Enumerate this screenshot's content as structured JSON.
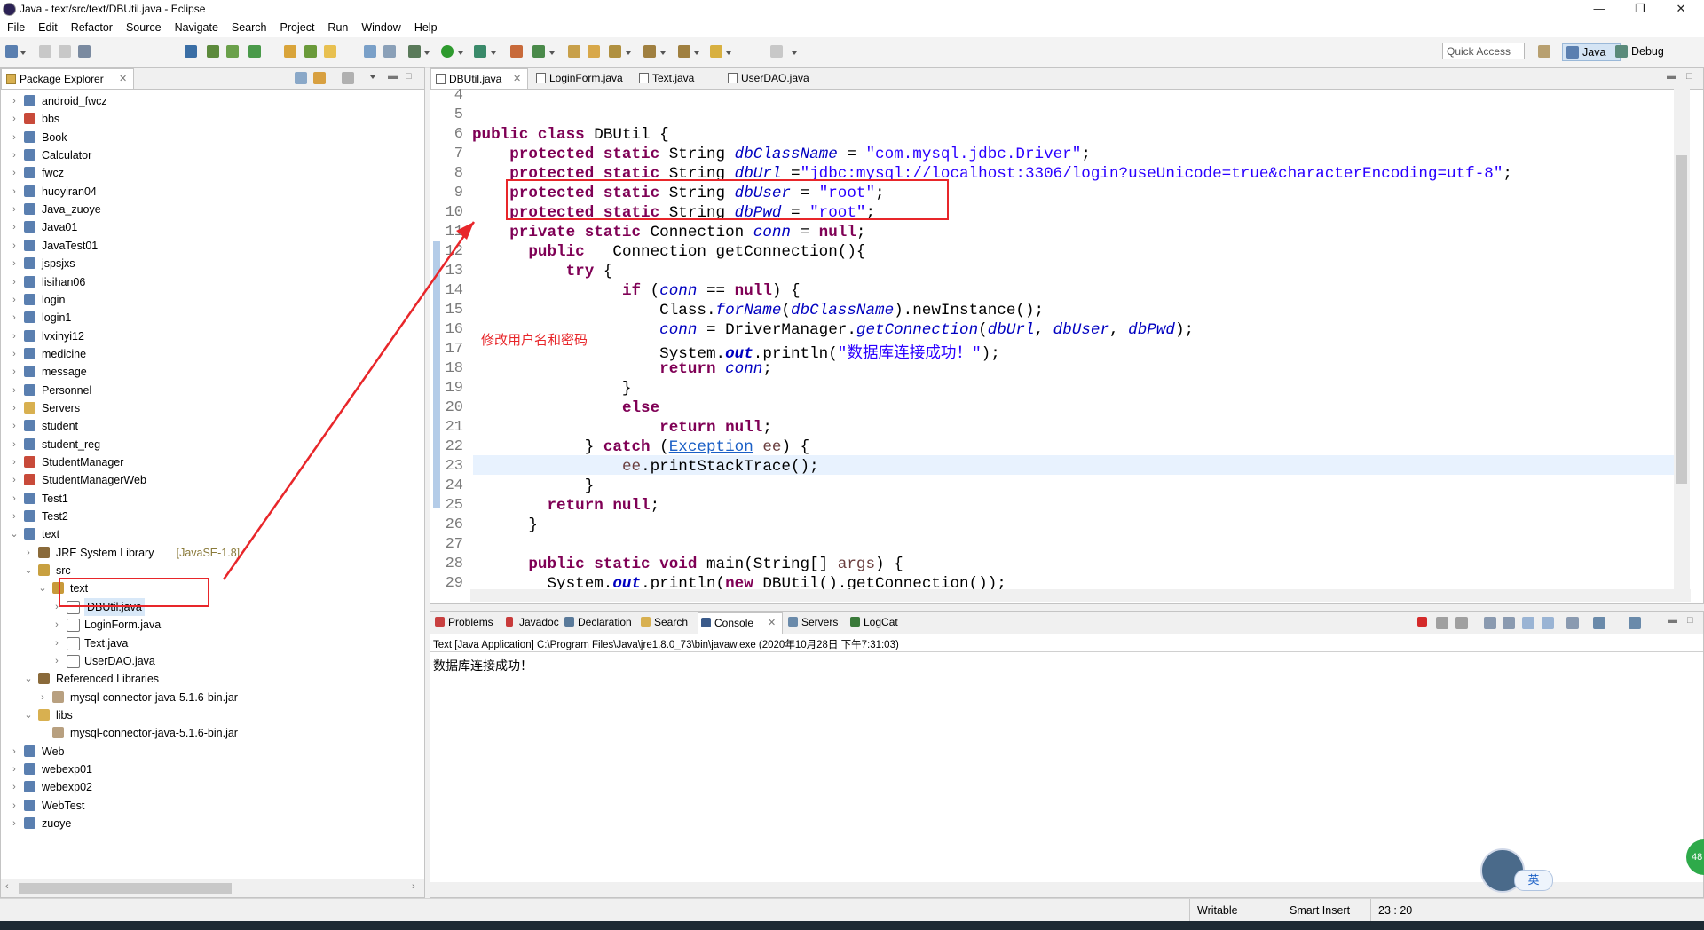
{
  "window": {
    "title": "Java - text/src/text/DBUtil.java - Eclipse"
  },
  "menu": [
    "File",
    "Edit",
    "Refactor",
    "Source",
    "Navigate",
    "Search",
    "Project",
    "Run",
    "Window",
    "Help"
  ],
  "toolbar": {
    "quick_access": "Quick Access"
  },
  "perspectives": {
    "java": "Java",
    "debug": "Debug"
  },
  "package_explorer": {
    "title": "Package Explorer",
    "items": [
      {
        "label": "android_fwcz",
        "depth": 0,
        "state": "closed",
        "icon": "project-icon"
      },
      {
        "label": "bbs",
        "depth": 0,
        "state": "closed",
        "icon": "project-error-icon"
      },
      {
        "label": "Book",
        "depth": 0,
        "state": "closed",
        "icon": "project-icon"
      },
      {
        "label": "Calculator",
        "depth": 0,
        "state": "closed",
        "icon": "project-icon"
      },
      {
        "label": "fwcz",
        "depth": 0,
        "state": "closed",
        "icon": "project-icon"
      },
      {
        "label": "huoyiran04",
        "depth": 0,
        "state": "closed",
        "icon": "project-icon"
      },
      {
        "label": "Java_zuoye",
        "depth": 0,
        "state": "closed",
        "icon": "project-icon"
      },
      {
        "label": "Java01",
        "depth": 0,
        "state": "closed",
        "icon": "project-icon"
      },
      {
        "label": "JavaTest01",
        "depth": 0,
        "state": "closed",
        "icon": "project-icon"
      },
      {
        "label": "jspsjxs",
        "depth": 0,
        "state": "closed",
        "icon": "project-icon"
      },
      {
        "label": "lisihan06",
        "depth": 0,
        "state": "closed",
        "icon": "project-icon"
      },
      {
        "label": "login",
        "depth": 0,
        "state": "closed",
        "icon": "project-icon"
      },
      {
        "label": "login1",
        "depth": 0,
        "state": "closed",
        "icon": "project-icon"
      },
      {
        "label": "lvxinyi12",
        "depth": 0,
        "state": "closed",
        "icon": "project-icon"
      },
      {
        "label": "medicine",
        "depth": 0,
        "state": "closed",
        "icon": "project-icon"
      },
      {
        "label": "message",
        "depth": 0,
        "state": "closed",
        "icon": "project-icon"
      },
      {
        "label": "Personnel",
        "depth": 0,
        "state": "closed",
        "icon": "project-icon"
      },
      {
        "label": "Servers",
        "depth": 0,
        "state": "closed",
        "icon": "folder-icon"
      },
      {
        "label": "student",
        "depth": 0,
        "state": "closed",
        "icon": "project-icon"
      },
      {
        "label": "student_reg",
        "depth": 0,
        "state": "closed",
        "icon": "project-icon"
      },
      {
        "label": "StudentManager",
        "depth": 0,
        "state": "closed",
        "icon": "project-error-icon"
      },
      {
        "label": "StudentManagerWeb",
        "depth": 0,
        "state": "closed",
        "icon": "project-error-icon"
      },
      {
        "label": "Test1",
        "depth": 0,
        "state": "closed",
        "icon": "project-icon"
      },
      {
        "label": "Test2",
        "depth": 0,
        "state": "closed",
        "icon": "project-icon"
      },
      {
        "label": "text",
        "depth": 0,
        "state": "open",
        "icon": "project-icon"
      },
      {
        "label": "JRE System Library",
        "suffix": "[JavaSE-1.8]",
        "depth": 1,
        "state": "closed",
        "icon": "library-icon"
      },
      {
        "label": "src",
        "depth": 1,
        "state": "open",
        "icon": "source-folder-icon"
      },
      {
        "label": "text",
        "depth": 2,
        "state": "open",
        "icon": "package-icon"
      },
      {
        "label": "DBUtil.java",
        "depth": 3,
        "state": "closed",
        "icon": "java-file-icon",
        "selected": true
      },
      {
        "label": "LoginForm.java",
        "depth": 3,
        "state": "closed",
        "icon": "java-file-icon"
      },
      {
        "label": "Text.java",
        "depth": 3,
        "state": "closed",
        "icon": "java-file-icon"
      },
      {
        "label": "UserDAO.java",
        "depth": 3,
        "state": "closed",
        "icon": "java-file-icon"
      },
      {
        "label": "Referenced Libraries",
        "depth": 1,
        "state": "open",
        "icon": "library-icon"
      },
      {
        "label": "mysql-connector-java-5.1.6-bin.jar",
        "depth": 2,
        "state": "closed",
        "icon": "jar-icon"
      },
      {
        "label": "libs",
        "depth": 1,
        "state": "open",
        "icon": "folder-icon"
      },
      {
        "label": "mysql-connector-java-5.1.6-bin.jar",
        "depth": 2,
        "state": "none",
        "icon": "jar-icon"
      },
      {
        "label": "Web",
        "depth": 0,
        "state": "closed",
        "icon": "project-icon"
      },
      {
        "label": "webexp01",
        "depth": 0,
        "state": "closed",
        "icon": "project-icon"
      },
      {
        "label": "webexp02",
        "depth": 0,
        "state": "closed",
        "icon": "project-icon"
      },
      {
        "label": "WebTest",
        "depth": 0,
        "state": "closed",
        "icon": "project-icon"
      },
      {
        "label": "zuoye",
        "depth": 0,
        "state": "closed",
        "icon": "project-icon"
      }
    ]
  },
  "editor": {
    "tabs": [
      "DBUtil.java",
      "LoginForm.java",
      "Text.java",
      "UserDAO.java"
    ],
    "line_numbers": [
      "4",
      "5",
      "6",
      "7",
      "8",
      "9",
      "10",
      "11",
      "12",
      "13",
      "14",
      "15",
      "16",
      "17",
      "18",
      "19",
      "20",
      "21",
      "22",
      "23",
      "24",
      "25",
      "26",
      "27",
      "28",
      "29"
    ],
    "lines": [
      [],
      [],
      [
        [
          "kw",
          "public class "
        ],
        [
          "",
          "DBUtil {"
        ]
      ],
      [
        [
          "",
          "    "
        ],
        [
          "kw",
          "protected static "
        ],
        [
          "",
          "String "
        ],
        [
          "fld",
          "dbClassName"
        ],
        [
          "",
          " = "
        ],
        [
          "st",
          "\"com.mysql.jdbc.Driver\""
        ],
        [
          "",
          ";"
        ]
      ],
      [
        [
          "",
          "    "
        ],
        [
          "kw",
          "protected static "
        ],
        [
          "",
          "String "
        ],
        [
          "fld",
          "dbUrl"
        ],
        [
          "",
          " ="
        ],
        [
          "st",
          "\"jdbc:mysql://localhost:3306/login?useUnicode=true&characterEncoding=utf-8\""
        ],
        [
          "",
          ";"
        ]
      ],
      [
        [
          "",
          "    "
        ],
        [
          "kw",
          "protected static "
        ],
        [
          "",
          "String "
        ],
        [
          "fld",
          "dbUser"
        ],
        [
          "",
          " = "
        ],
        [
          "st",
          "\"root\""
        ],
        [
          "",
          ";"
        ]
      ],
      [
        [
          "",
          "    "
        ],
        [
          "kw",
          "protected static "
        ],
        [
          "",
          "String "
        ],
        [
          "fld",
          "dbPwd"
        ],
        [
          "",
          " = "
        ],
        [
          "st",
          "\"root\""
        ],
        [
          "",
          ";"
        ]
      ],
      [
        [
          "",
          "    "
        ],
        [
          "kw",
          "private static "
        ],
        [
          "",
          "Connection "
        ],
        [
          "fld",
          "conn"
        ],
        [
          "",
          " = "
        ],
        [
          "kw",
          "null"
        ],
        [
          "",
          ";"
        ]
      ],
      [
        [
          "",
          "      "
        ],
        [
          "kw",
          "public "
        ],
        [
          "",
          "  Connection getConnection(){"
        ]
      ],
      [
        [
          "",
          "          "
        ],
        [
          "kw",
          "try "
        ],
        [
          "",
          "{"
        ]
      ],
      [
        [
          "",
          "                "
        ],
        [
          "kw",
          "if "
        ],
        [
          "",
          "("
        ],
        [
          "fld",
          "conn"
        ],
        [
          "",
          " == "
        ],
        [
          "kw",
          "null"
        ],
        [
          "",
          ") {"
        ]
      ],
      [
        [
          "",
          "                    Class."
        ],
        [
          "fld",
          "forName"
        ],
        [
          "",
          "("
        ],
        [
          "fld",
          "dbClassName"
        ],
        [
          "",
          ").newInstance();"
        ]
      ],
      [
        [
          "",
          "                    "
        ],
        [
          "fld",
          "conn"
        ],
        [
          "",
          " = DriverManager."
        ],
        [
          "fld",
          "getConnection"
        ],
        [
          "",
          "("
        ],
        [
          "fld",
          "dbUrl"
        ],
        [
          "",
          ", "
        ],
        [
          "fld",
          "dbUser"
        ],
        [
          "",
          ", "
        ],
        [
          "fld",
          "dbPwd"
        ],
        [
          "",
          ");"
        ]
      ],
      [
        [
          "",
          "                    System."
        ],
        [
          "sfld",
          "out"
        ],
        [
          "",
          ".println("
        ],
        [
          "st",
          "\"数据库连接成功！\""
        ],
        [
          "",
          ");"
        ]
      ],
      [
        [
          "",
          "                    "
        ],
        [
          "kw",
          "return "
        ],
        [
          "fld",
          "conn"
        ],
        [
          "",
          ";"
        ]
      ],
      [
        [
          "",
          "                }"
        ]
      ],
      [
        [
          "",
          "                "
        ],
        [
          "kw",
          "else"
        ]
      ],
      [
        [
          "",
          "                    "
        ],
        [
          "kw",
          "return null"
        ],
        [
          "",
          ";"
        ]
      ],
      [
        [
          "",
          "            } "
        ],
        [
          "kw",
          "catch "
        ],
        [
          "",
          "("
        ],
        [
          "link",
          "Exception"
        ],
        [
          "",
          " "
        ],
        [
          "local",
          "ee"
        ],
        [
          "",
          ") {"
        ]
      ],
      [
        [
          "",
          "                "
        ],
        [
          "local",
          "ee"
        ],
        [
          "",
          ".printStackTrace();"
        ]
      ],
      [
        [
          "",
          "            }"
        ]
      ],
      [
        [
          "",
          "        "
        ],
        [
          "kw",
          "return null"
        ],
        [
          "",
          ";"
        ]
      ],
      [
        [
          "",
          "      }"
        ]
      ],
      [],
      [
        [
          "",
          "      "
        ],
        [
          "kw",
          "public static void "
        ],
        [
          "",
          "main(String[] "
        ],
        [
          "local",
          "args"
        ],
        [
          "",
          ") {"
        ]
      ],
      [
        [
          "",
          "        System."
        ],
        [
          "sfld",
          "out"
        ],
        [
          "",
          ".println("
        ],
        [
          "kw",
          "new "
        ],
        [
          "",
          "DBUtil().getConnection());"
        ]
      ]
    ],
    "annotation": "修改用户名和密码"
  },
  "console": {
    "tabs": [
      "Problems",
      "Javadoc",
      "Declaration",
      "Search",
      "Console",
      "Servers",
      "LogCat"
    ],
    "header": "Text [Java Application] C:\\Program Files\\Java\\jre1.8.0_73\\bin\\javaw.exe (2020年10月28日 下午7:31:03)",
    "output": "数据库连接成功！"
  },
  "status": {
    "writable": "Writable",
    "insert_mode": "Smart Insert",
    "position": "23 : 20"
  },
  "ime": {
    "lang": "英",
    "badge": "48"
  },
  "colors": {
    "accent": "#1a5fc6",
    "annotation_red": "#e8262a",
    "keyword": "#7f0055",
    "field": "#0000c0",
    "string": "#2a00ff"
  }
}
